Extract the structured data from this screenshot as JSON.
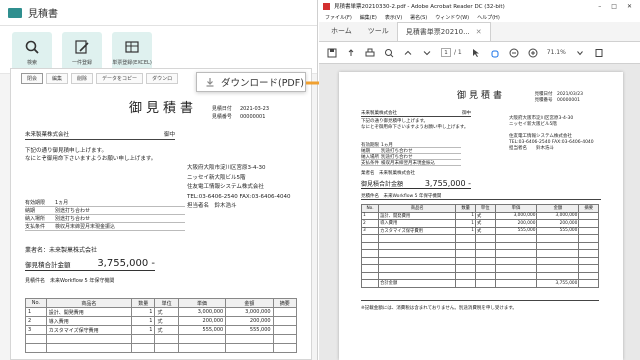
{
  "left_app": {
    "title": "見積書",
    "toolbar": [
      {
        "label": "検索",
        "icon": "search-icon"
      },
      {
        "label": "一件登録",
        "icon": "edit-icon"
      },
      {
        "label": "単票登録(EXCEL)",
        "icon": "spreadsheet-icon"
      }
    ],
    "doc_toolbar": [
      "閉会",
      "編集",
      "削除",
      "データをコピー",
      "ダウンロ"
    ],
    "download_button": "ダウンロード(PDF)",
    "paper": {
      "title": "御見積書",
      "issue_date_label": "見積日付",
      "issue_date": "2021-03-23",
      "number_label": "見積番号",
      "number": "00000001",
      "customer": "株式会社　御中",
      "customer_name": "未来製菓株式会社",
      "customer_suffix": "御中",
      "intro_1": "下記の通り御見積申し上げます。",
      "intro_2": "なにとぞ御用命下さいますようお願い申し上げます。",
      "company": [
        "大阪府大阪市淀川区宮原3-4-30",
        "ニッセイ新大阪ビル5階",
        "住友電工情報システム株式会社",
        "TEL:03-6406-2540 FAX:03-6406-4040",
        "担当者名　鈴木浩斗"
      ],
      "fields": [
        {
          "k": "有効期限",
          "v": "1ヵ月"
        },
        {
          "k": "納期",
          "v": "別途打ち合わせ"
        },
        {
          "k": "納入場所",
          "v": "別途打ち合わせ"
        },
        {
          "k": "支払条件",
          "v": "検収月末締翌月末現金振込"
        }
      ],
      "subject_label": "件名",
      "subject": "業者名：未来製菓株式会社",
      "total_label": "御見積合計金額",
      "total": "3,755,000 -",
      "project": "見積件名　未来Workflow 5 年保守機関",
      "table_headers": [
        "No.",
        "商品名",
        "数量",
        "単位",
        "単価",
        "金額",
        "摘要"
      ],
      "rows": [
        [
          "1",
          "設計、開発費用",
          "1",
          "式",
          "3,000,000",
          "3,000,000",
          ""
        ],
        [
          "2",
          "導入費用",
          "1",
          "式",
          "200,000",
          "200,000",
          ""
        ],
        [
          "3",
          "カスタマイズ保守費用",
          "1",
          "式",
          "555,000",
          "555,000",
          ""
        ],
        [
          "",
          "",
          "",
          "",
          "",
          "",
          ""
        ],
        [
          "",
          "",
          "",
          "",
          "",
          "",
          ""
        ]
      ]
    }
  },
  "right_app": {
    "window_title": "見積書単票20210330-2.pdf - Adobe Acrobat Reader DC (32-bit)",
    "menu": [
      "ファイル(F)",
      "編集(E)",
      "表示(V)",
      "署名(S)",
      "ウィンドウ(W)",
      "ヘルプ(H)"
    ],
    "tabs": {
      "home": "ホーム",
      "tools": "ツール",
      "doc": "見積書単票20210..."
    },
    "page_current": "1",
    "page_total": "/ 1",
    "zoom": "71.1%",
    "pdf": {
      "title": "御見積書",
      "meta": [
        "見積日付　2021/03/23",
        "見積番号　00000001"
      ],
      "customer": "未来製菓株式会社",
      "customer_suffix": "御中",
      "intro_1": "下記の通り御見積申し上げます。",
      "intro_2": "なにとぞ御用命下さいますようお願い申し上げます。",
      "company": [
        "大阪府大阪市淀川区宮原3-4-30",
        "ニッセイ新大阪ビル5階",
        "",
        "住友電工情報システム株式会社",
        "TEL:03-6406-2540 FAX:03-6406-4040",
        "担当者名　　鈴木浩斗"
      ],
      "fields": [
        {
          "k": "有効期限",
          "v": "1ヵ月"
        },
        {
          "k": "納期",
          "v": "別途打ち合わせ"
        },
        {
          "k": "納入場所",
          "v": "別途打ち合わせ"
        },
        {
          "k": "支払条件",
          "v": "検収月末締翌月末現金振込"
        }
      ],
      "subject": "業者名　未来製菓株式会社",
      "total_label": "御見積合計金額",
      "total": "3,755,000 -",
      "project": "見積件名　未来Workflow 5 年保守機関",
      "table_headers": [
        "No.",
        "商品名",
        "数量",
        "単位",
        "単価",
        "金額",
        "摘要"
      ],
      "rows": [
        [
          "1",
          "設計、開発費用",
          "1",
          "式",
          "3,000,000",
          "3,000,000",
          ""
        ],
        [
          "2",
          "導入費用",
          "1",
          "式",
          "200,000",
          "200,000",
          ""
        ],
        [
          "3",
          "カスタマイズ保守費用",
          "1",
          "式",
          "555,000",
          "555,000",
          ""
        ],
        [
          "",
          "",
          "",
          "",
          "",
          "",
          ""
        ],
        [
          "",
          "",
          "",
          "",
          "",
          "",
          ""
        ],
        [
          "",
          "",
          "",
          "",
          "",
          "",
          ""
        ],
        [
          "",
          "",
          "",
          "",
          "",
          "",
          ""
        ],
        [
          "",
          "",
          "",
          "",
          "",
          "",
          ""
        ],
        [
          "",
          "",
          "",
          "",
          "",
          "",
          ""
        ],
        [
          "",
          "合計金額",
          "",
          "",
          "",
          "3,755,000",
          ""
        ]
      ],
      "note": "※記載金額には、消費税は含まれておりません。別途消費税を申し受けます。"
    }
  },
  "colors": {
    "accent_teal": "#2f8f8f",
    "tool_bg": "#dff1ef",
    "arrow_orange": "#f0a030"
  }
}
